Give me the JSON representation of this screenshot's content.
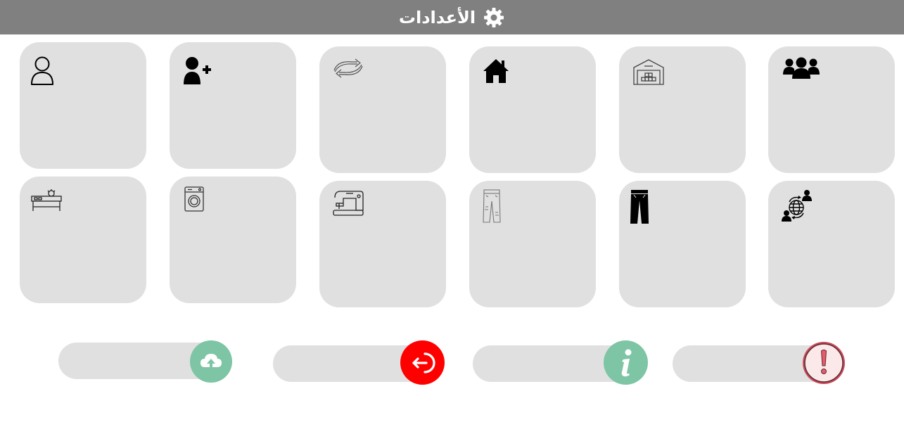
{
  "header": {
    "title": "الأعدادات",
    "icon": "gear-icon"
  },
  "tiles_row1": [
    {
      "icon": "user-icon"
    },
    {
      "icon": "add-user-icon"
    },
    {
      "icon": "sync-arrows-icon"
    },
    {
      "icon": "home-icon"
    },
    {
      "icon": "warehouse-icon"
    },
    {
      "icon": "users-group-icon"
    }
  ],
  "tiles_row2": [
    {
      "icon": "cutting-table-icon"
    },
    {
      "icon": "washing-machine-icon"
    },
    {
      "icon": "sewing-machine-icon"
    },
    {
      "icon": "ripped-jeans-icon"
    },
    {
      "icon": "trousers-icon"
    },
    {
      "icon": "global-network-icon"
    }
  ],
  "actions": [
    {
      "icon": "cloud-upload-icon",
      "color": "#7dc5a5"
    },
    {
      "icon": "logout-icon",
      "color": "#ff0000"
    },
    {
      "icon": "info-icon",
      "color": "#7dc5a5"
    },
    {
      "icon": "warning-icon",
      "color": "#e85a6a"
    }
  ]
}
